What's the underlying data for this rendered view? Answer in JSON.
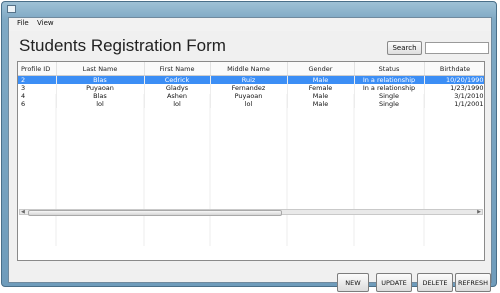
{
  "window": {
    "title": ""
  },
  "menu": {
    "items": [
      "File",
      "View"
    ]
  },
  "form": {
    "title": "Students Registration Form"
  },
  "search": {
    "button_label": "Search",
    "value": ""
  },
  "table": {
    "columns": [
      "Profile ID",
      "Last Name",
      "First Name",
      "Middle Name",
      "Gender",
      "Status",
      "Birthdate"
    ],
    "rows": [
      [
        "2",
        "Blas",
        "Cedrick",
        "Ruiz",
        "Male",
        "In a relationship",
        "10/20/1990"
      ],
      [
        "3",
        "Puyaoan",
        "Gladys",
        "Fernandez",
        "Female",
        "In a relationship",
        "1/23/1990"
      ],
      [
        "4",
        "Blas",
        "Ashen",
        "Puyaoan",
        "Male",
        "Single",
        "3/1/2010"
      ],
      [
        "6",
        "lol",
        "lol",
        "lol",
        "Male",
        "Single",
        "1/1/2001"
      ]
    ],
    "selected_row": 0
  },
  "scrollbar": {
    "position": 0
  },
  "buttons": {
    "new": "NEW",
    "update": "UPDATE",
    "delete": "DELETE",
    "refresh": "REFRESH"
  },
  "colors": {
    "selection": "#3c8ef5",
    "window_frame": "#7fa9c4"
  },
  "icons": [
    "app-icon",
    "scroll-left-icon",
    "scroll-right-icon"
  ]
}
